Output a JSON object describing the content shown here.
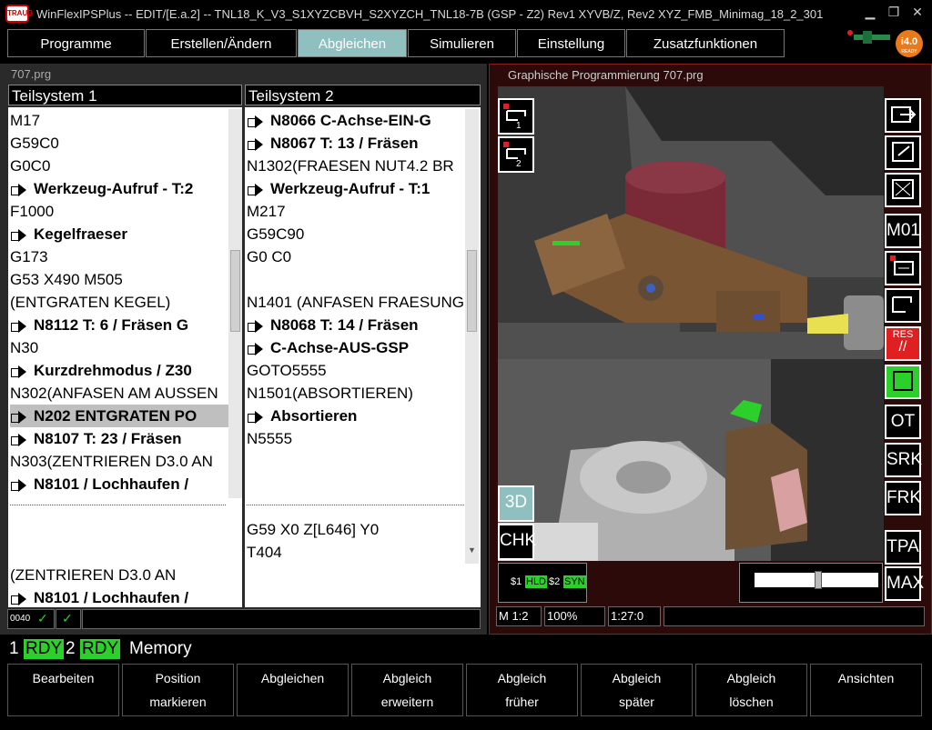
{
  "window": {
    "logo_text": "TRAUB",
    "title": "WinFlexIPSPlus -- EDIT/[E.a.2] -- TNL18_K_V3_S1XYZCBVH_S2XYZCH_TNL18-7B (GSP - Z2)   Rev1 XYVB/Z, Rev2 XYZ_FMB_Minimag_18_2_301",
    "minimize": "▁",
    "restore": "❐",
    "close": "✕"
  },
  "menu": {
    "tabs": [
      "Programme",
      "Erstellen/Ändern",
      "Abgleichen",
      "Simulieren",
      "Einstellung",
      "Zusatzfunktionen"
    ],
    "active": 2,
    "badge_text": "i4.0",
    "badge_sub": "READY"
  },
  "left_panel": {
    "title": "707.prg",
    "col1_header": "Teilsystem 1",
    "col2_header": "Teilsystem 2",
    "col1_lines": [
      {
        "t": "M17",
        "b": false,
        "a": false
      },
      {
        "t": "G59C0",
        "b": false,
        "a": false
      },
      {
        "t": "G0C0",
        "b": false,
        "a": false
      },
      {
        "t": "Werkzeug-Aufruf - T:2",
        "b": true,
        "a": true
      },
      {
        "t": "F1000",
        "b": false,
        "a": false
      },
      {
        "t": "Kegelfraeser",
        "b": true,
        "a": true
      },
      {
        "t": "G173",
        "b": false,
        "a": false
      },
      {
        "t": "G53 X490 M505",
        "b": false,
        "a": false
      },
      {
        "t": "(ENTGRATEN KEGEL)",
        "b": false,
        "a": false
      },
      {
        "t": "N8112 T: 6 / Fräsen G",
        "b": true,
        "a": true
      },
      {
        "t": "N30",
        "b": false,
        "a": false
      },
      {
        "t": "Kurzdrehmodus / Z30",
        "b": true,
        "a": true
      },
      {
        "t": "N302(ANFASEN AM AUSSEN",
        "b": false,
        "a": false
      },
      {
        "t": "N202 ENTGRATEN PO",
        "b": true,
        "a": true,
        "hl": true
      },
      {
        "t": "N8107 T: 23 / Fräsen",
        "b": true,
        "a": true
      },
      {
        "t": "N303(ZENTRIEREN D3.0 AN",
        "b": false,
        "a": false
      },
      {
        "t": "N8101 / Lochhaufen /",
        "b": true,
        "a": true
      }
    ],
    "col1_lines_lower": [
      {
        "t": " (ZENTRIEREN          D3.0 AN",
        "b": false,
        "a": false
      },
      {
        "t": "N8101 / Lochhaufen /",
        "b": true,
        "a": true
      }
    ],
    "col2_lines": [
      {
        "t": "N8066 C-Achse-EIN-G",
        "b": true,
        "a": true
      },
      {
        "t": "N8067 T: 13 / Fräsen",
        "b": true,
        "a": true
      },
      {
        "t": "N1302(FRAESEN NUT4.2 BR",
        "b": false,
        "a": false
      },
      {
        "t": "Werkzeug-Aufruf - T:1",
        "b": true,
        "a": true
      },
      {
        "t": "M217",
        "b": false,
        "a": false
      },
      {
        "t": "G59C90",
        "b": false,
        "a": false
      },
      {
        "t": "G0 C0",
        "b": false,
        "a": false
      },
      {
        "t": "",
        "b": false,
        "a": false
      },
      {
        "t": "N1401 (ANFASEN FRAESUNG",
        "b": false,
        "a": false
      },
      {
        "t": "N8068 T: 14 / Fräsen",
        "b": true,
        "a": true
      },
      {
        "t": "C-Achse-AUS-GSP",
        "b": true,
        "a": true
      },
      {
        "t": "GOTO5555",
        "b": false,
        "a": false
      },
      {
        "t": "N1501(ABSORTIEREN)",
        "b": false,
        "a": false
      },
      {
        "t": "Absortieren",
        "b": true,
        "a": true
      },
      {
        "t": "N5555",
        "b": false,
        "a": false
      }
    ],
    "col2_lines_lower": [
      {
        "t": "G59 X0 Z[L646] Y0",
        "b": false,
        "a": false
      },
      {
        "t": "T404",
        "b": false,
        "a": false
      }
    ],
    "status_count": "0040",
    "check": "✓"
  },
  "right_panel": {
    "title": "Graphische Programmierung  707.prg",
    "left_btns": [
      "3D",
      "CHK"
    ],
    "right_btns": [
      "M01",
      "RES",
      "OT",
      "SRK",
      "FRK",
      "TPA",
      "MAX"
    ],
    "channel": {
      "s1": "$1",
      "hld": "HLD",
      "s2": "$2",
      "syn": "SYN"
    },
    "status": {
      "scale": "M 1:2",
      "zoom": "100%",
      "time": "1:27:0"
    }
  },
  "bottom_status": {
    "ch1": "1",
    "rdy1": "RDY",
    "ch2": "2",
    "rdy2": "RDY",
    "mode": "Memory"
  },
  "fkeys": [
    [
      "Bearbeiten",
      ""
    ],
    [
      "Position",
      "markieren"
    ],
    [
      "Abgleichen",
      ""
    ],
    [
      "Abgleich",
      "erweitern"
    ],
    [
      "Abgleich",
      "früher"
    ],
    [
      "Abgleich",
      "später"
    ],
    [
      "Abgleich",
      "löschen"
    ],
    [
      "Ansichten",
      ""
    ]
  ],
  "colors": {
    "accent_tab": "#8fbfbf",
    "rdy": "#2bd02b",
    "panel_red": "#8b1a1a",
    "res": "#e02020"
  }
}
